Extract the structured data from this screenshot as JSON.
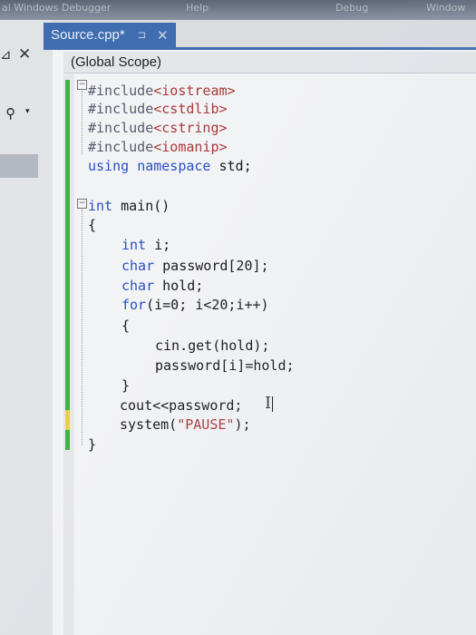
{
  "window": {
    "top_menu": [
      "al Windows Debugger",
      "Help",
      "Debug",
      "Window"
    ]
  },
  "left_panel": {
    "pin_glyph": "⊿",
    "close_glyph": "✕",
    "search_icon": "search-icon",
    "dropdown_glyph": "▾"
  },
  "tab": {
    "label": "Source.cpp*",
    "pin_glyph": "⊐",
    "close_glyph": "✕"
  },
  "scope": {
    "label": "(Global Scope)"
  },
  "code_lines": [
    {
      "tokens": [
        {
          "t": "#include",
          "c": "pp"
        },
        {
          "t": "<iostream>",
          "c": "inc"
        }
      ]
    },
    {
      "tokens": [
        {
          "t": "#include",
          "c": "pp"
        },
        {
          "t": "<cstdlib>",
          "c": "inc"
        }
      ]
    },
    {
      "tokens": [
        {
          "t": "#include",
          "c": "pp"
        },
        {
          "t": "<cstring>",
          "c": "inc"
        }
      ]
    },
    {
      "tokens": [
        {
          "t": "#include",
          "c": "pp"
        },
        {
          "t": "<iomanip>",
          "c": "inc"
        }
      ]
    },
    {
      "tokens": [
        {
          "t": "using",
          "c": "kw"
        },
        {
          "t": " "
        },
        {
          "t": "namespace",
          "c": "kw"
        },
        {
          "t": " std;"
        }
      ]
    },
    {
      "tokens": []
    },
    {
      "tokens": [
        {
          "t": "int",
          "c": "kw"
        },
        {
          "t": " main()"
        }
      ]
    },
    {
      "tokens": [
        {
          "t": "{"
        }
      ]
    },
    {
      "tokens": [
        {
          "t": "int",
          "c": "kw"
        },
        {
          "t": " i;"
        }
      ]
    },
    {
      "tokens": [
        {
          "t": "char",
          "c": "kw"
        },
        {
          "t": " password[20];"
        }
      ]
    },
    {
      "tokens": [
        {
          "t": "char",
          "c": "kw"
        },
        {
          "t": " hold;"
        }
      ]
    },
    {
      "tokens": [
        {
          "t": "for",
          "c": "kw"
        },
        {
          "t": "(i=0; i<20;i++)"
        }
      ]
    },
    {
      "tokens": [
        {
          "t": "{"
        }
      ]
    },
    {
      "tokens": [
        {
          "t": "cin.get(hold);"
        }
      ]
    },
    {
      "tokens": [
        {
          "t": "password[i]=hold;"
        }
      ]
    },
    {
      "tokens": [
        {
          "t": "}"
        }
      ]
    },
    {
      "tokens": [
        {
          "t": "cout<<password;"
        }
      ]
    },
    {
      "tokens": [
        {
          "t": "system("
        },
        {
          "t": "\"PAUSE\"",
          "c": "str"
        },
        {
          "t": ");"
        }
      ]
    },
    {
      "tokens": [
        {
          "t": "}"
        }
      ]
    }
  ],
  "colors": {
    "keyword": "#2a4fc7",
    "include": "#a83a3a",
    "tab": "#3f6db0",
    "change_bar": "#3fb44a",
    "unsaved_bar": "#e6d04a"
  }
}
